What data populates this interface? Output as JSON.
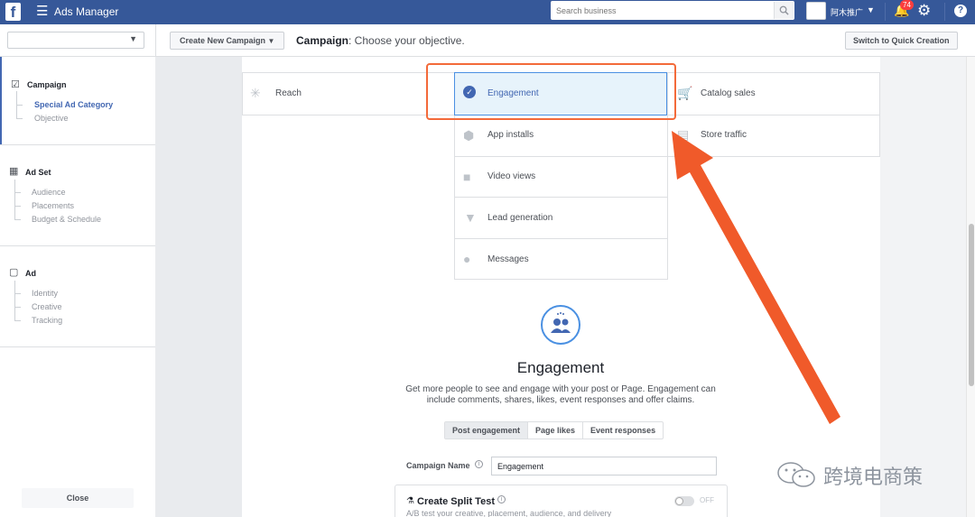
{
  "topbar": {
    "logo": "f",
    "app_title": "Ads Manager",
    "search_placeholder": "Search business",
    "account_name": "阿木推广",
    "notification_count": "74"
  },
  "subbar": {
    "create_label": "Create New Campaign",
    "title_bold": "Campaign",
    "title_rest": ": Choose your objective.",
    "quick_label": "Switch to Quick Creation"
  },
  "sidebar": {
    "campaign": {
      "title": "Campaign",
      "items": [
        "Special Ad Category",
        "Objective"
      ]
    },
    "adset": {
      "title": "Ad Set",
      "items": [
        "Audience",
        "Placements",
        "Budget & Schedule"
      ]
    },
    "ad": {
      "title": "Ad",
      "items": [
        "Identity",
        "Creative",
        "Tracking"
      ]
    },
    "close_label": "Close"
  },
  "objectives": {
    "reach": "Reach",
    "engagement": "Engagement",
    "app_installs": "App installs",
    "video_views": "Video views",
    "lead_generation": "Lead generation",
    "messages": "Messages",
    "catalog_sales": "Catalog sales",
    "store_traffic": "Store traffic"
  },
  "detail": {
    "title": "Engagement",
    "description": "Get more people to see and engage with your post or Page. Engagement can include comments, shares, likes, event responses and offer claims.",
    "tabs": [
      "Post engagement",
      "Page likes",
      "Event responses"
    ],
    "campaign_name_label": "Campaign Name",
    "campaign_name_value": "Engagement",
    "split_title": "Create Split Test",
    "split_desc": "A/B test your creative, placement, audience, and delivery",
    "toggle_label": "OFF"
  },
  "watermark": "跨境电商策",
  "colors": {
    "brand": "#365899",
    "accent": "#4267b2",
    "highlight": "#f36a3a"
  }
}
